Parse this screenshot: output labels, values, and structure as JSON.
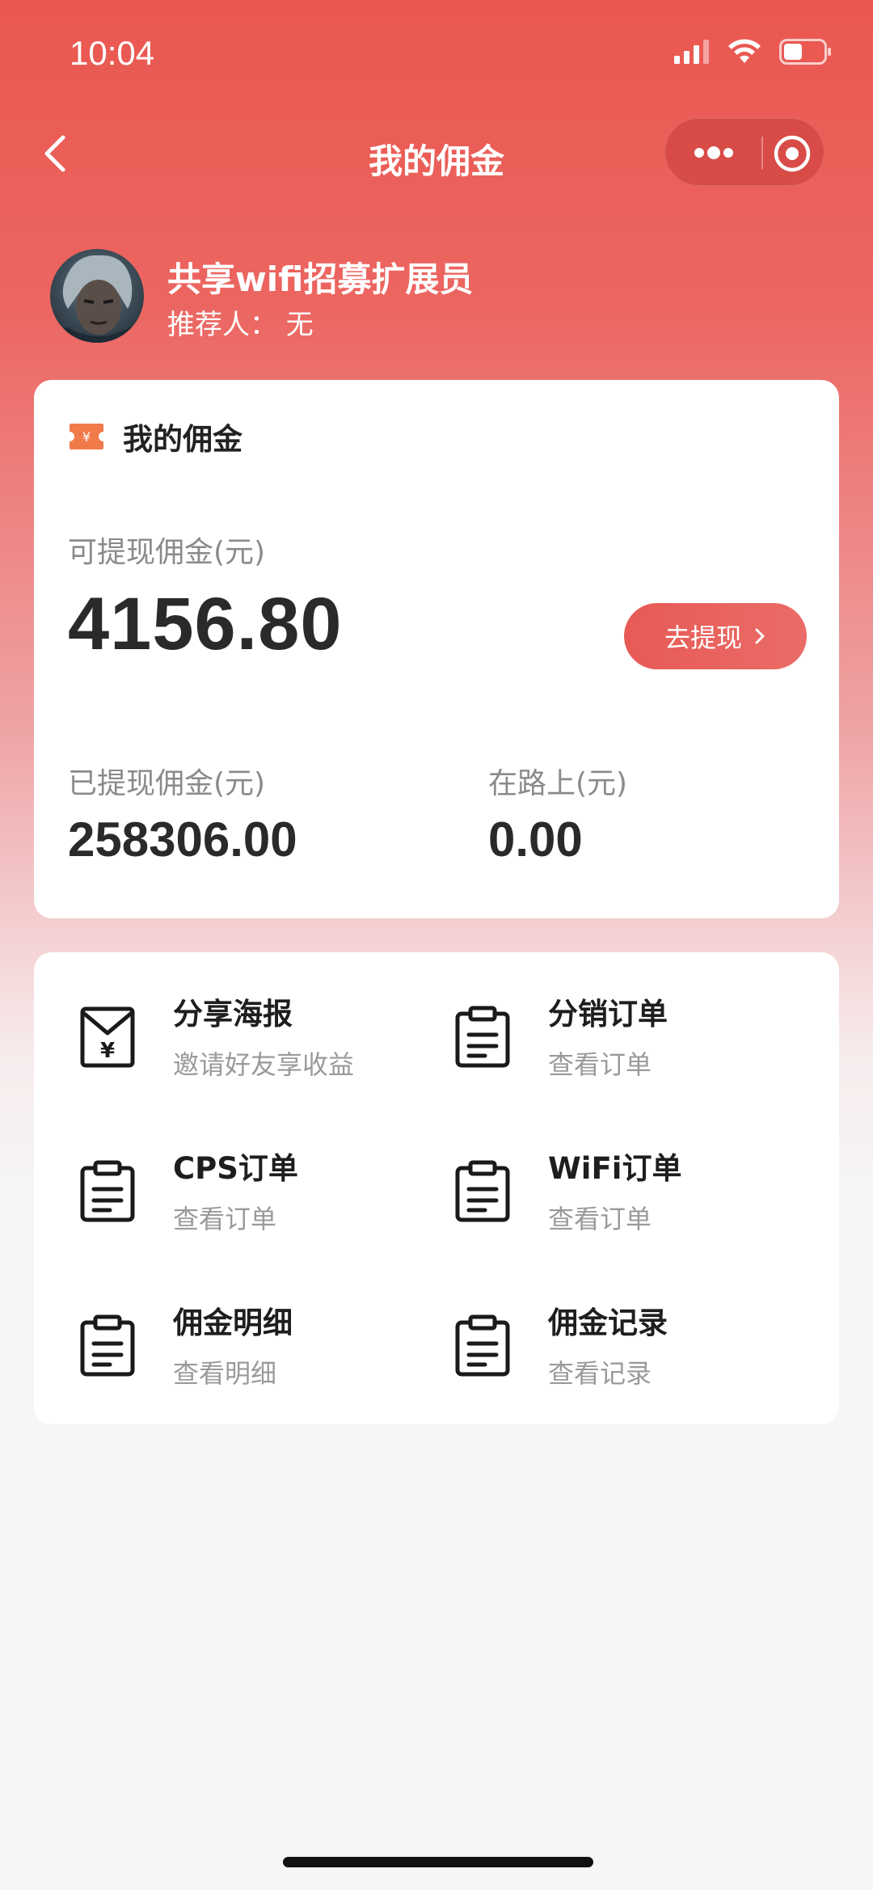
{
  "status_bar": {
    "time": "10:04"
  },
  "nav": {
    "title": "我的佣金"
  },
  "profile": {
    "name": "共享wifi招募扩展员",
    "referrer": "推荐人：  无"
  },
  "wallet": {
    "title": "我的佣金",
    "available_label": "可提现佣金(元)",
    "available_value": "4156.80",
    "withdraw_button": "去提现",
    "withdrawn_label": "已提现佣金(元)",
    "withdrawn_value": "258306.00",
    "transit_label": "在路上(元)",
    "transit_value": "0.00"
  },
  "menu": {
    "items": [
      {
        "title": "分享海报",
        "subtitle": "邀请好友享收益",
        "icon": "poster-yen-icon"
      },
      {
        "title": "分销订单",
        "subtitle": "查看订单",
        "icon": "clipboard-icon"
      },
      {
        "title": "CPS订单",
        "subtitle": "查看订单",
        "icon": "clipboard-icon"
      },
      {
        "title": "WiFi订单",
        "subtitle": "查看订单",
        "icon": "clipboard-icon"
      },
      {
        "title": "佣金明细",
        "subtitle": "查看明细",
        "icon": "clipboard-icon"
      },
      {
        "title": "佣金记录",
        "subtitle": "查看记录",
        "icon": "clipboard-icon"
      }
    ]
  },
  "colors": {
    "accent": "#ea5750",
    "ticket_icon": "#f07a4a"
  }
}
